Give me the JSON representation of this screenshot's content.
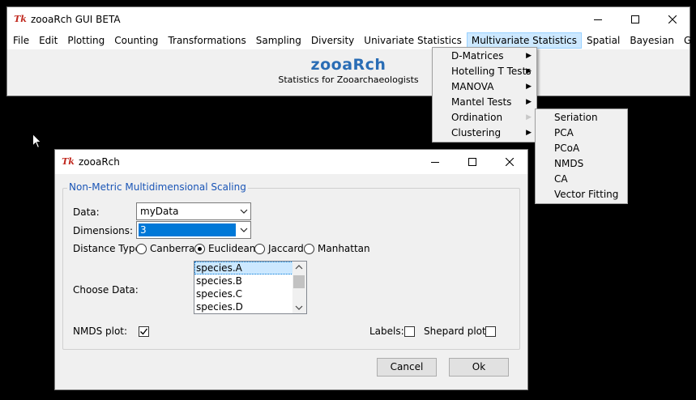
{
  "main_window": {
    "title": "zooaRch GUI BETA",
    "menus": [
      "File",
      "Edit",
      "Plotting",
      "Counting",
      "Transformations",
      "Sampling",
      "Diversity",
      "Univariate Statistics",
      "Multivariate Statistics",
      "Spatial",
      "Bayesian",
      "GMM"
    ],
    "logo_text": "zooaRch",
    "subtitle": "Statistics for Zooarchaeologists"
  },
  "multivariate_menu": {
    "items": [
      "D-Matrices",
      "Hotelling T Tests",
      "MANOVA",
      "Mantel Tests",
      "Ordination",
      "Clustering"
    ]
  },
  "ordination_submenu": {
    "items": [
      "Seriation",
      "PCA",
      "PCoA",
      "NMDS",
      "CA",
      "Vector Fitting"
    ]
  },
  "dialog": {
    "title": "zooaRch",
    "group_title": "Non-Metric Multidimensional Scaling",
    "data_label": "Data:",
    "data_value": "myData",
    "dimensions_label": "Dimensions:",
    "dimensions_value": "3",
    "distance_label": "Distance Type",
    "distance_options": [
      "Canberra",
      "Euclidean",
      "Jaccard",
      "Manhattan"
    ],
    "distance_selected": "Euclidean",
    "choose_label": "Choose Data:",
    "choose_items": [
      "species.A",
      "species.B",
      "species.C",
      "species.D"
    ],
    "choose_selected": "species.A",
    "nmds_plot_label": "NMDS plot:",
    "nmds_plot_checked": true,
    "labels_label": "Labels:",
    "labels_checked": false,
    "shepard_label": "Shepard plot:",
    "shepard_checked": false,
    "cancel_label": "Cancel",
    "ok_label": "Ok"
  }
}
